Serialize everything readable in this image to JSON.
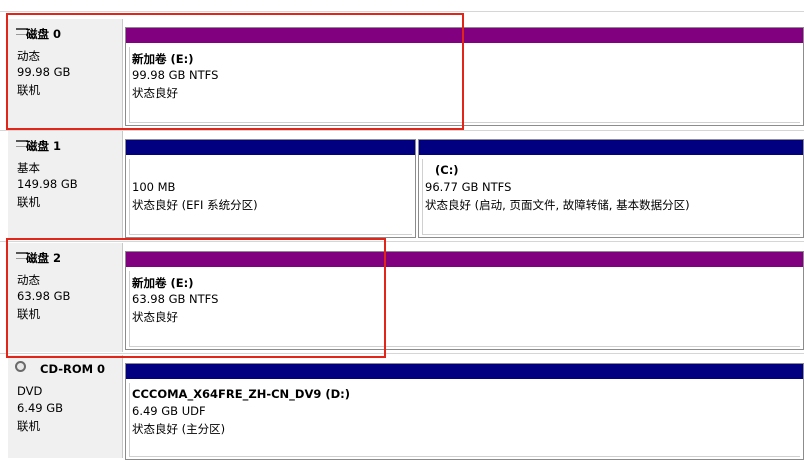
{
  "disks": [
    {
      "name": "磁盘 0",
      "type": "动态",
      "size": "99.98 GB",
      "status": "联机",
      "partitions": [
        {
          "name": "新加卷  (E:)",
          "size_fs": "99.98 GB NTFS",
          "health": "状态良好"
        }
      ]
    },
    {
      "name": "磁盘 1",
      "type": "基本",
      "size": "149.98 GB",
      "status": "联机",
      "partitions": [
        {
          "name": "",
          "size_fs": "100 MB",
          "health": "状态良好 (EFI 系统分区)"
        },
        {
          "name": "(C:)",
          "size_fs": "96.77 GB NTFS",
          "health": "状态良好 (启动, 页面文件, 故障转储, 基本数据分区)"
        }
      ]
    },
    {
      "name": "磁盘 2",
      "type": "动态",
      "size": "63.98 GB",
      "status": "联机",
      "partitions": [
        {
          "name": "新加卷  (E:)",
          "size_fs": "63.98 GB NTFS",
          "health": "状态良好"
        }
      ]
    },
    {
      "name": "CD-ROM 0",
      "type": "DVD",
      "size": "6.49 GB",
      "status": "联机",
      "partitions": [
        {
          "name": "CCCOMA_X64FRE_ZH-CN_DV9  (D:)",
          "size_fs": "6.49 GB UDF",
          "health": "状态良好 (主分区)"
        }
      ]
    }
  ],
  "colors": {
    "dynamic": "#800080",
    "basic": "#000080",
    "highlight": "#e0251b"
  }
}
